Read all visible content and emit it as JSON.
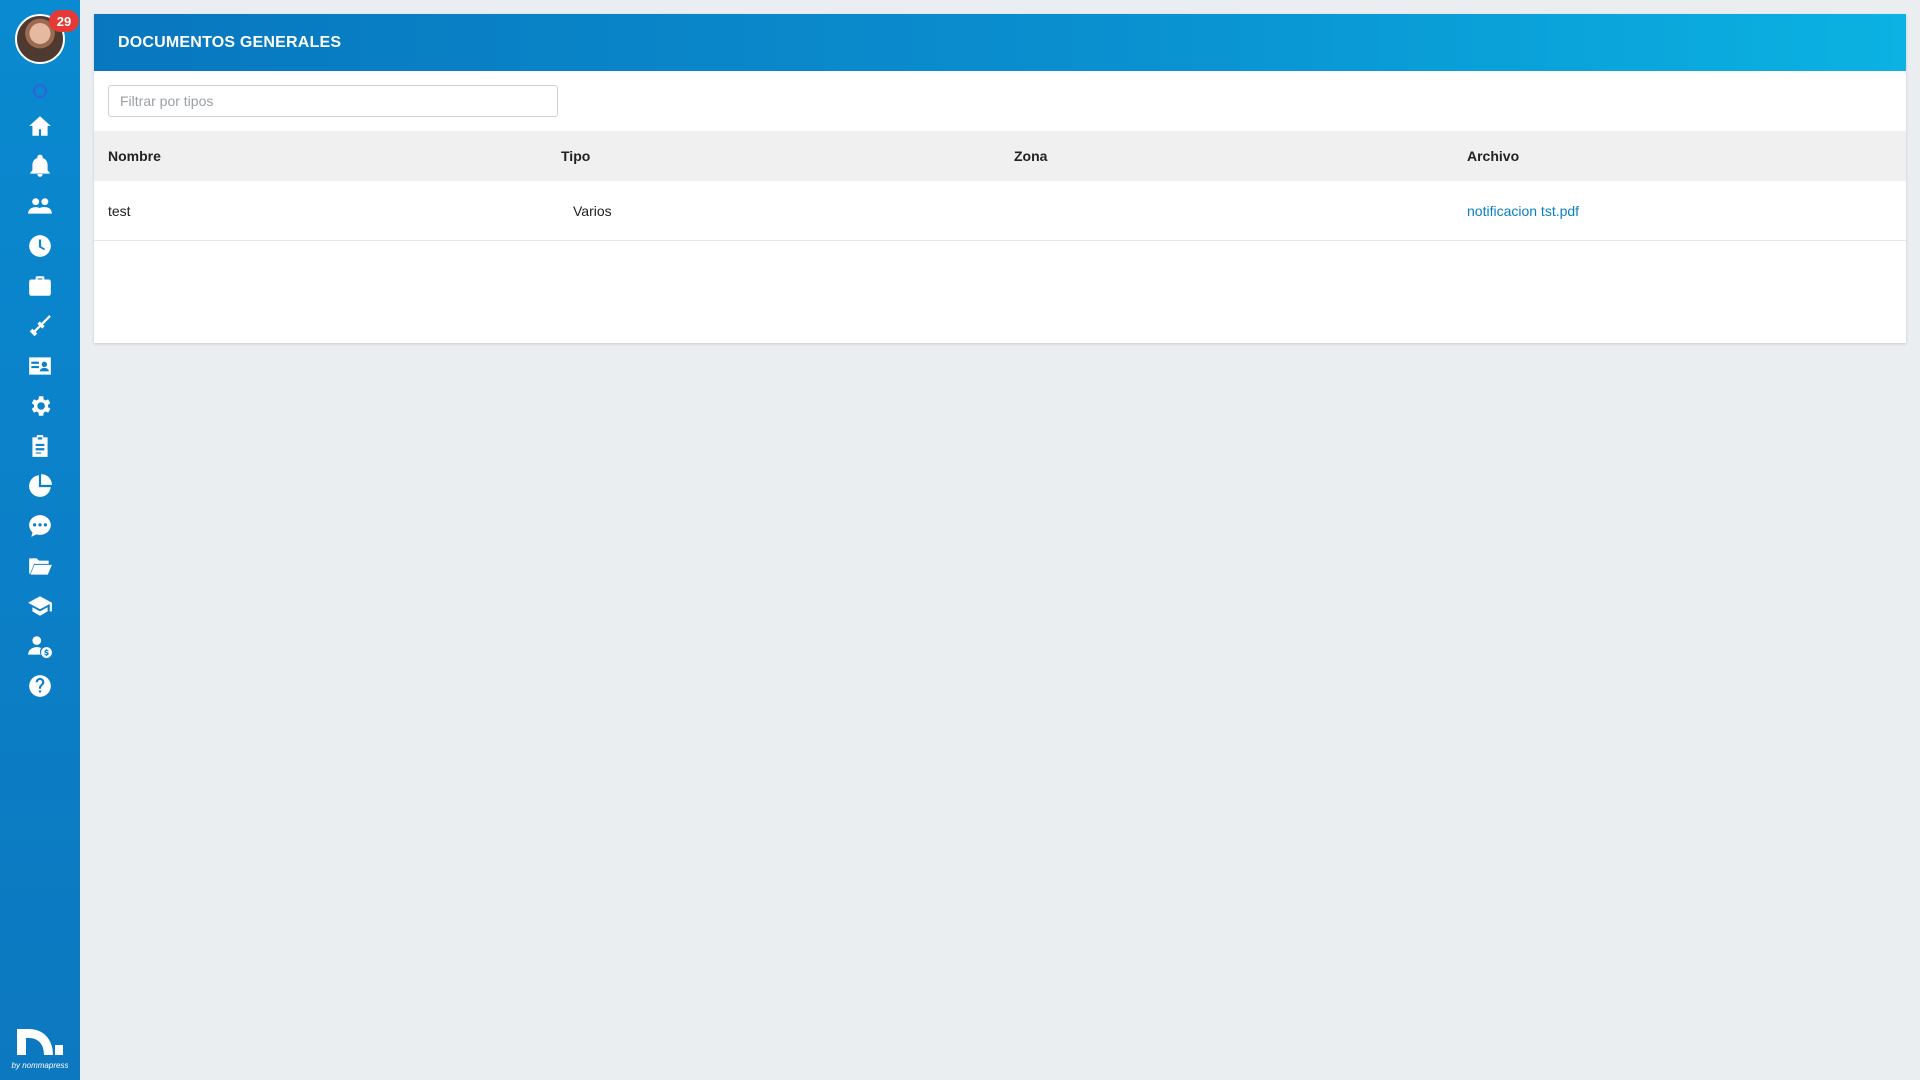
{
  "sidebar": {
    "badge_count": "29",
    "nav_items": [
      {
        "icon": "home-icon"
      },
      {
        "icon": "bell-icon"
      },
      {
        "icon": "users-icon"
      },
      {
        "icon": "clock-icon"
      },
      {
        "icon": "briefcase-icon"
      },
      {
        "icon": "broom-icon"
      },
      {
        "icon": "id-card-icon"
      },
      {
        "icon": "gear-icon"
      },
      {
        "icon": "clipboard-icon"
      },
      {
        "icon": "pie-chart-icon"
      },
      {
        "icon": "chat-icon"
      },
      {
        "icon": "folder-open-icon"
      },
      {
        "icon": "graduation-cap-icon"
      },
      {
        "icon": "user-dollar-icon"
      },
      {
        "icon": "help-icon"
      }
    ],
    "logo_text": "by nommapress",
    "accent_color": "#0a8ad0"
  },
  "card": {
    "title": "DOCUMENTOS GENERALES",
    "filter_placeholder": "Filtrar por tipos",
    "filter_value": ""
  },
  "table": {
    "headers": [
      "Nombre",
      "Tipo",
      "Zona",
      "Archivo"
    ],
    "rows": [
      {
        "nombre": "test",
        "tipo": "Varios",
        "zona": "",
        "archivo": "notificacion tst.pdf"
      }
    ]
  }
}
